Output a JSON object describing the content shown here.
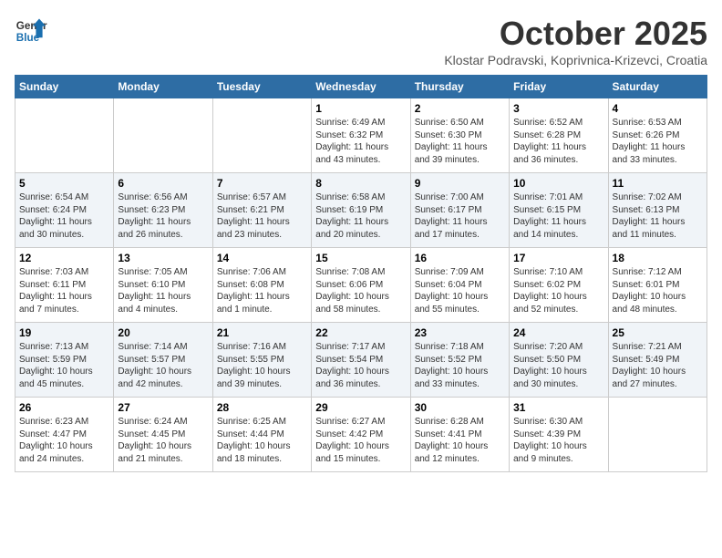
{
  "header": {
    "logo_line1": "General",
    "logo_line2": "Blue",
    "month": "October 2025",
    "location": "Klostar Podravski, Koprivnica-Krizevci, Croatia"
  },
  "weekdays": [
    "Sunday",
    "Monday",
    "Tuesday",
    "Wednesday",
    "Thursday",
    "Friday",
    "Saturday"
  ],
  "weeks": [
    [
      {
        "day": "",
        "info": ""
      },
      {
        "day": "",
        "info": ""
      },
      {
        "day": "",
        "info": ""
      },
      {
        "day": "1",
        "info": "Sunrise: 6:49 AM\nSunset: 6:32 PM\nDaylight: 11 hours\nand 43 minutes."
      },
      {
        "day": "2",
        "info": "Sunrise: 6:50 AM\nSunset: 6:30 PM\nDaylight: 11 hours\nand 39 minutes."
      },
      {
        "day": "3",
        "info": "Sunrise: 6:52 AM\nSunset: 6:28 PM\nDaylight: 11 hours\nand 36 minutes."
      },
      {
        "day": "4",
        "info": "Sunrise: 6:53 AM\nSunset: 6:26 PM\nDaylight: 11 hours\nand 33 minutes."
      }
    ],
    [
      {
        "day": "5",
        "info": "Sunrise: 6:54 AM\nSunset: 6:24 PM\nDaylight: 11 hours\nand 30 minutes."
      },
      {
        "day": "6",
        "info": "Sunrise: 6:56 AM\nSunset: 6:23 PM\nDaylight: 11 hours\nand 26 minutes."
      },
      {
        "day": "7",
        "info": "Sunrise: 6:57 AM\nSunset: 6:21 PM\nDaylight: 11 hours\nand 23 minutes."
      },
      {
        "day": "8",
        "info": "Sunrise: 6:58 AM\nSunset: 6:19 PM\nDaylight: 11 hours\nand 20 minutes."
      },
      {
        "day": "9",
        "info": "Sunrise: 7:00 AM\nSunset: 6:17 PM\nDaylight: 11 hours\nand 17 minutes."
      },
      {
        "day": "10",
        "info": "Sunrise: 7:01 AM\nSunset: 6:15 PM\nDaylight: 11 hours\nand 14 minutes."
      },
      {
        "day": "11",
        "info": "Sunrise: 7:02 AM\nSunset: 6:13 PM\nDaylight: 11 hours\nand 11 minutes."
      }
    ],
    [
      {
        "day": "12",
        "info": "Sunrise: 7:03 AM\nSunset: 6:11 PM\nDaylight: 11 hours\nand 7 minutes."
      },
      {
        "day": "13",
        "info": "Sunrise: 7:05 AM\nSunset: 6:10 PM\nDaylight: 11 hours\nand 4 minutes."
      },
      {
        "day": "14",
        "info": "Sunrise: 7:06 AM\nSunset: 6:08 PM\nDaylight: 11 hours\nand 1 minute."
      },
      {
        "day": "15",
        "info": "Sunrise: 7:08 AM\nSunset: 6:06 PM\nDaylight: 10 hours\nand 58 minutes."
      },
      {
        "day": "16",
        "info": "Sunrise: 7:09 AM\nSunset: 6:04 PM\nDaylight: 10 hours\nand 55 minutes."
      },
      {
        "day": "17",
        "info": "Sunrise: 7:10 AM\nSunset: 6:02 PM\nDaylight: 10 hours\nand 52 minutes."
      },
      {
        "day": "18",
        "info": "Sunrise: 7:12 AM\nSunset: 6:01 PM\nDaylight: 10 hours\nand 48 minutes."
      }
    ],
    [
      {
        "day": "19",
        "info": "Sunrise: 7:13 AM\nSunset: 5:59 PM\nDaylight: 10 hours\nand 45 minutes."
      },
      {
        "day": "20",
        "info": "Sunrise: 7:14 AM\nSunset: 5:57 PM\nDaylight: 10 hours\nand 42 minutes."
      },
      {
        "day": "21",
        "info": "Sunrise: 7:16 AM\nSunset: 5:55 PM\nDaylight: 10 hours\nand 39 minutes."
      },
      {
        "day": "22",
        "info": "Sunrise: 7:17 AM\nSunset: 5:54 PM\nDaylight: 10 hours\nand 36 minutes."
      },
      {
        "day": "23",
        "info": "Sunrise: 7:18 AM\nSunset: 5:52 PM\nDaylight: 10 hours\nand 33 minutes."
      },
      {
        "day": "24",
        "info": "Sunrise: 7:20 AM\nSunset: 5:50 PM\nDaylight: 10 hours\nand 30 minutes."
      },
      {
        "day": "25",
        "info": "Sunrise: 7:21 AM\nSunset: 5:49 PM\nDaylight: 10 hours\nand 27 minutes."
      }
    ],
    [
      {
        "day": "26",
        "info": "Sunrise: 6:23 AM\nSunset: 4:47 PM\nDaylight: 10 hours\nand 24 minutes."
      },
      {
        "day": "27",
        "info": "Sunrise: 6:24 AM\nSunset: 4:45 PM\nDaylight: 10 hours\nand 21 minutes."
      },
      {
        "day": "28",
        "info": "Sunrise: 6:25 AM\nSunset: 4:44 PM\nDaylight: 10 hours\nand 18 minutes."
      },
      {
        "day": "29",
        "info": "Sunrise: 6:27 AM\nSunset: 4:42 PM\nDaylight: 10 hours\nand 15 minutes."
      },
      {
        "day": "30",
        "info": "Sunrise: 6:28 AM\nSunset: 4:41 PM\nDaylight: 10 hours\nand 12 minutes."
      },
      {
        "day": "31",
        "info": "Sunrise: 6:30 AM\nSunset: 4:39 PM\nDaylight: 10 hours\nand 9 minutes."
      },
      {
        "day": "",
        "info": ""
      }
    ]
  ]
}
